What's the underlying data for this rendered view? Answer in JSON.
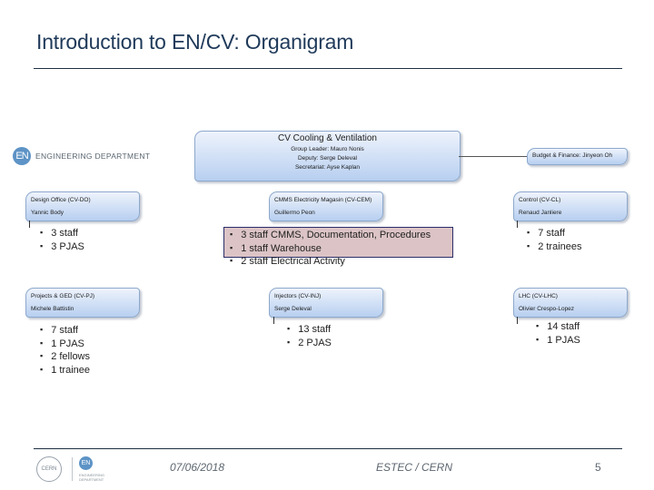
{
  "slide": {
    "title": "Introduction to EN/CV: Organigram"
  },
  "dept_logo": {
    "badge": "EN",
    "label": "ENGINEERING DEPARTMENT"
  },
  "org": {
    "cv": {
      "head": "CV   Cooling & Ventilation",
      "group_leader": "Group Leader: Mauro Nonis",
      "deputy": "Deputy: Serge Deleval",
      "secretariat": "Secretariat: Ayse Kaplan"
    },
    "budget": {
      "label": "Budget & Finance: Jinyeon Oh"
    },
    "units": [
      {
        "name": "Design Office (CV-DO)",
        "leader": "Yannic Body",
        "bullets": [
          "3 staff",
          "3 PJAS"
        ]
      },
      {
        "name": "CMMS Electricity Magasin (CV-CEM)",
        "leader": "Guillermo Peon",
        "bullets": [
          "3 staff CMMS, Documentation, Procedures",
          "1 staff Warehouse",
          "2 staff Electrical Activity"
        ]
      },
      {
        "name": "Control (CV-CL)",
        "leader": "Renaud Janliere",
        "bullets": [
          "7 staff",
          "2 trainees"
        ]
      },
      {
        "name": "Projects & GED (CV-PJ)",
        "leader": "Michele Battistin",
        "bullets": [
          "7 staff",
          "1 PJAS",
          "2 fellows",
          "1 trainee"
        ]
      },
      {
        "name": "Injectors (CV-INJ)",
        "leader": "Serge Deleval",
        "bullets": [
          "13 staff",
          "2 PJAS"
        ]
      },
      {
        "name": "LHC (CV-LHC)",
        "leader": "Olivier Crespo-Lopez",
        "bullets": [
          "14 staff",
          "1 PJAS"
        ]
      }
    ]
  },
  "footer": {
    "date": "07/06/2018",
    "venue": "ESTEC / CERN",
    "page": "5",
    "cern_logo": "CERN",
    "en_badge": "EN",
    "en_label": "ENGINEERING DEPARTMENT"
  },
  "colors": {
    "title": "#1f3a5a",
    "box_top": "#eef3fc",
    "box_bottom": "#b7cff0",
    "highlight": "#dcc4c6",
    "en_blue": "#5d93c6"
  }
}
